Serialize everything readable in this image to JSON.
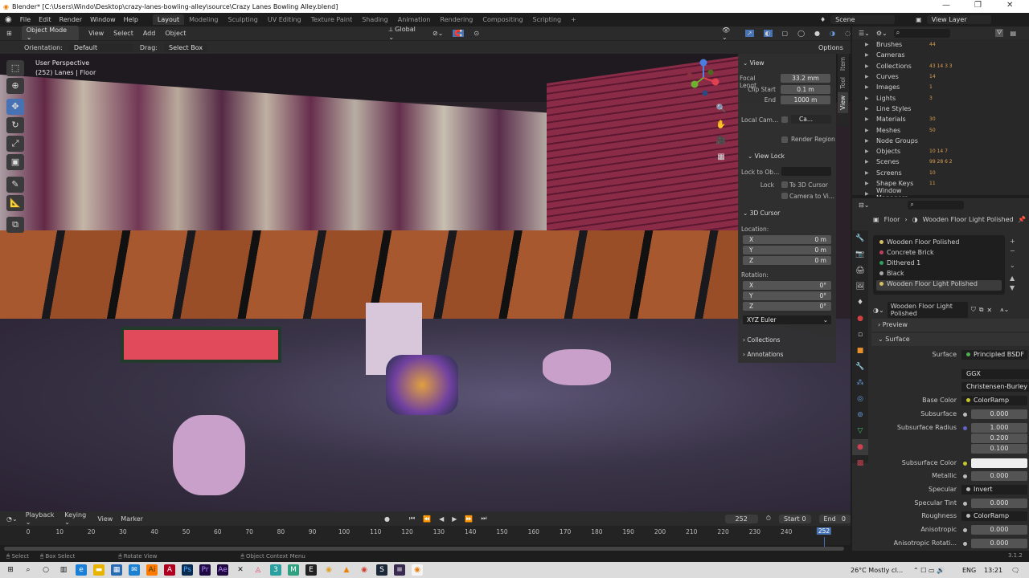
{
  "window": {
    "title": "Blender* [C:\\Users\\Windo\\Desktop\\crazy-lanes-bowling-alley\\source\\Crazy Lanes Bowling Alley.blend]",
    "minimize": "—",
    "maximize": "❐",
    "close": "✕"
  },
  "menu": [
    "File",
    "Edit",
    "Render",
    "Window",
    "Help"
  ],
  "workspaces": [
    "Layout",
    "Modeling",
    "Sculpting",
    "UV Editing",
    "Texture Paint",
    "Shading",
    "Animation",
    "Rendering",
    "Compositing",
    "Scripting",
    "+"
  ],
  "active_workspace": "Layout",
  "scene": "Scene",
  "view_layer": "View Layer",
  "viewport_header": {
    "mode": "Object Mode",
    "menus": [
      "View",
      "Select",
      "Add",
      "Object"
    ],
    "transform": "Global",
    "options": "Options"
  },
  "tool_settings": {
    "orientation_label": "Orientation:",
    "orientation": "Default",
    "drag_label": "Drag:",
    "drag": "Select Box"
  },
  "hud": {
    "line1": "User Perspective",
    "line2": "(252) Lanes | Floor"
  },
  "npanel": {
    "tabs": [
      "Item",
      "Tool",
      "View"
    ],
    "active_tab": "View",
    "view": {
      "title": "View",
      "focal_label": "Focal Lengt",
      "focal": "33.2 mm",
      "clip_start_label": "Clip Start",
      "clip_start": "0.1 m",
      "end_label": "End",
      "end": "1000 m",
      "local_cam_label": "Local Cam...",
      "local_cam": "Ca...",
      "render_region": "Render Region"
    },
    "view_lock": {
      "title": "View Lock",
      "lock_obj_label": "Lock to Ob...",
      "lock_label": "Lock",
      "to_cursor": "To 3D Cursor",
      "camera_to_view": "Camera to Vi..."
    },
    "cursor": {
      "title": "3D Cursor",
      "location": "Location:",
      "lx": "0 m",
      "ly": "0 m",
      "lz": "0 m",
      "rotation": "Rotation:",
      "rx": "0°",
      "ry": "0°",
      "rz": "0°",
      "mode": "XYZ Euler",
      "x": "X",
      "y": "Y",
      "z": "Z"
    },
    "collections": "Collections",
    "annotations": "Annotations"
  },
  "outliner": {
    "items": [
      {
        "label": "Brushes",
        "badge": "44"
      },
      {
        "label": "Cameras",
        "badge": ""
      },
      {
        "label": "Collections",
        "badge": "43 14 3 3"
      },
      {
        "label": "Curves",
        "badge": "14"
      },
      {
        "label": "Images",
        "badge": "1"
      },
      {
        "label": "Lights",
        "badge": "3"
      },
      {
        "label": "Line Styles",
        "badge": ""
      },
      {
        "label": "Materials",
        "badge": "30"
      },
      {
        "label": "Meshes",
        "badge": "50"
      },
      {
        "label": "Node Groups",
        "badge": ""
      },
      {
        "label": "Objects",
        "badge": "10 14 7"
      },
      {
        "label": "Scenes",
        "badge": "99 28 6 2"
      },
      {
        "label": "Screens",
        "badge": "10"
      },
      {
        "label": "Shape Keys",
        "badge": "11"
      },
      {
        "label": "Window Managers",
        "badge": ""
      }
    ]
  },
  "properties": {
    "breadcrumb": [
      "Floor",
      "Wooden Floor Light Polished"
    ],
    "slots": [
      "Wooden Floor Polished",
      "Concrete Brick",
      "Dithered 1",
      "Black",
      "Wooden Floor Light Polished"
    ],
    "active_slot": "Wooden Floor Light Polished",
    "material": "Wooden Floor Light Polished",
    "preview": "Preview",
    "surface_section": "Surface",
    "rows": [
      {
        "label": "Surface",
        "value": "Principled BSDF",
        "kind": "link",
        "color": "#4caf50"
      },
      {
        "label": "",
        "value": "GGX",
        "kind": "menu"
      },
      {
        "label": "",
        "value": "Christensen-Burley",
        "kind": "menu"
      },
      {
        "label": "Base Color",
        "value": "ColorRamp",
        "kind": "link",
        "color": "#c7c729"
      },
      {
        "label": "Subsurface",
        "value": "0.000",
        "kind": "num"
      },
      {
        "label": "Subsurface Radius",
        "value": "1.000",
        "kind": "num",
        "color": "#6363c7"
      },
      {
        "label": "",
        "value": "0.200",
        "kind": "num"
      },
      {
        "label": "",
        "value": "0.100",
        "kind": "num"
      },
      {
        "label": "Subsurface Color",
        "value": "",
        "kind": "color",
        "color": "#c7c729"
      },
      {
        "label": "Metallic",
        "value": "0.000",
        "kind": "num"
      },
      {
        "label": "Specular",
        "value": "Invert",
        "kind": "link"
      },
      {
        "label": "Specular Tint",
        "value": "0.000",
        "kind": "num"
      },
      {
        "label": "Roughness",
        "value": "ColorRamp",
        "kind": "link"
      },
      {
        "label": "Anisotropic",
        "value": "0.000",
        "kind": "num"
      },
      {
        "label": "Anisotropic Rotati...",
        "value": "0.000",
        "kind": "num"
      }
    ],
    "version": "3.1.2"
  },
  "timeline": {
    "menus": [
      "Playback",
      "Keying",
      "View",
      "Marker"
    ],
    "current_frame": "252",
    "start_label": "Start",
    "start": "0",
    "end_label": "End",
    "end": "0",
    "ticks": [
      "0",
      "10",
      "20",
      "30",
      "40",
      "50",
      "60",
      "70",
      "80",
      "90",
      "100",
      "110",
      "120",
      "130",
      "140",
      "150",
      "160",
      "170",
      "180",
      "190",
      "200",
      "210",
      "220",
      "230",
      "240"
    ],
    "playhead": "252"
  },
  "status": [
    "Select",
    "Box Select",
    "Rotate View",
    "Object Context Menu"
  ],
  "taskbar": {
    "weather": "26°C  Mostly cl...",
    "lang": "ENG",
    "time": "13:21"
  },
  "colors": {
    "accent": "#4772b3",
    "header": "#303030",
    "panel": "#2b2b2b"
  }
}
